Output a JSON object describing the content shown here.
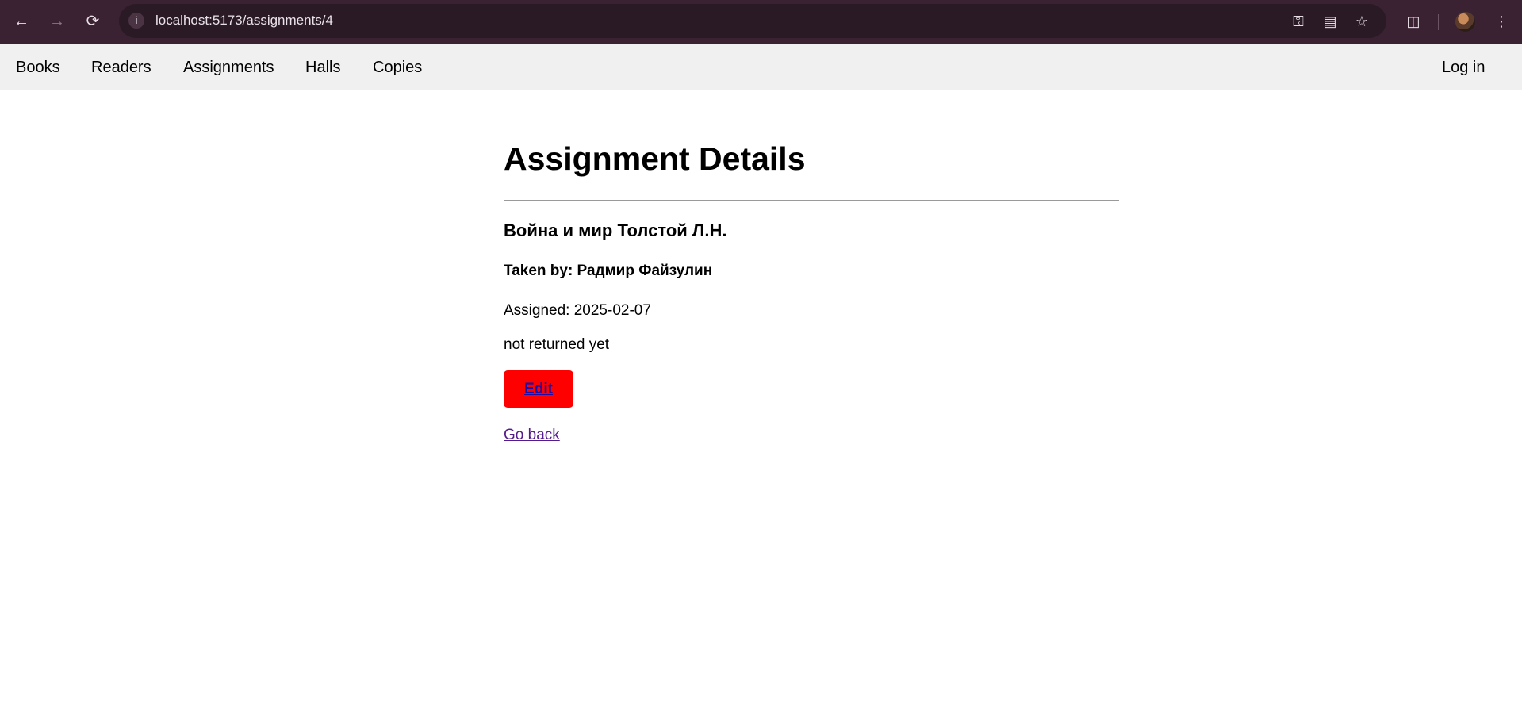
{
  "browser": {
    "url": "localhost:5173/assignments/4"
  },
  "nav": {
    "links": [
      "Books",
      "Readers",
      "Assignments",
      "Halls",
      "Copies"
    ],
    "login": "Log in"
  },
  "page": {
    "title": "Assignment Details",
    "book": "Война и мир Толстой Л.Н.",
    "taken_by": "Taken by: Радмир Файзулин",
    "assigned": "Assigned: 2025-02-07",
    "return_status": "not returned yet",
    "edit_label": "Edit",
    "go_back_label": "Go back"
  },
  "colors": {
    "edit_button": "#ff0000",
    "nav_background": "#f0f0f0"
  }
}
